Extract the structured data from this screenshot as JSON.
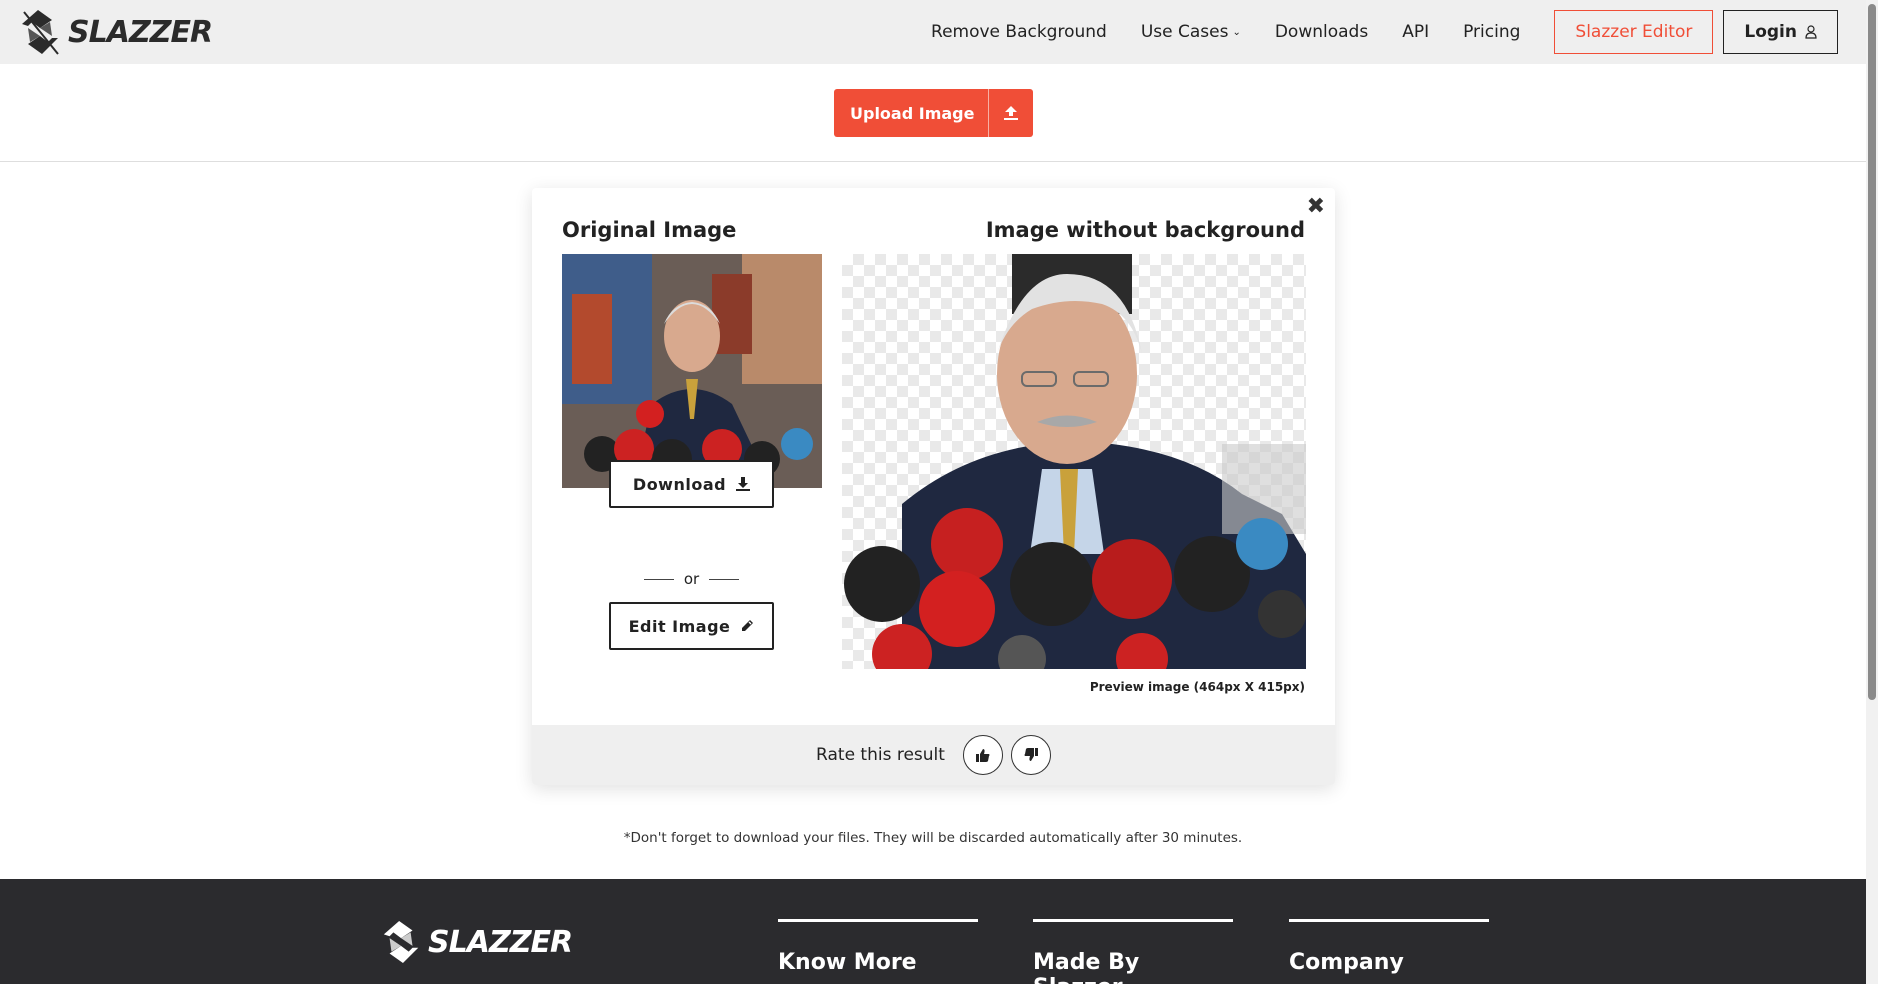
{
  "header": {
    "logo_text": "SLAZZER",
    "nav": [
      {
        "label": "Remove Background"
      },
      {
        "label": "Use Cases",
        "has_dropdown": true
      },
      {
        "label": "Downloads"
      },
      {
        "label": "API"
      },
      {
        "label": "Pricing"
      }
    ],
    "editor_label": "Slazzer Editor",
    "login_label": "Login"
  },
  "upload": {
    "label": "Upload Image"
  },
  "card": {
    "original_title": "Original Image",
    "result_title": "Image without background",
    "download_label": "Download",
    "or_label": "or",
    "edit_label": "Edit Image",
    "preview_note": "Preview image (464px X 415px)",
    "rate_label": "Rate this result"
  },
  "disclaimer": "*Don't forget to download your files. They will be discarded automatically after 30 minutes.",
  "footer": {
    "logo_text": "SLAZZER",
    "columns": [
      {
        "title": "Know More"
      },
      {
        "title": "Made By Slazzer"
      },
      {
        "title": "Company"
      }
    ]
  },
  "colors": {
    "accent": "#f04e37",
    "footer_bg": "#2b2b2e",
    "header_bg": "#efefef"
  }
}
